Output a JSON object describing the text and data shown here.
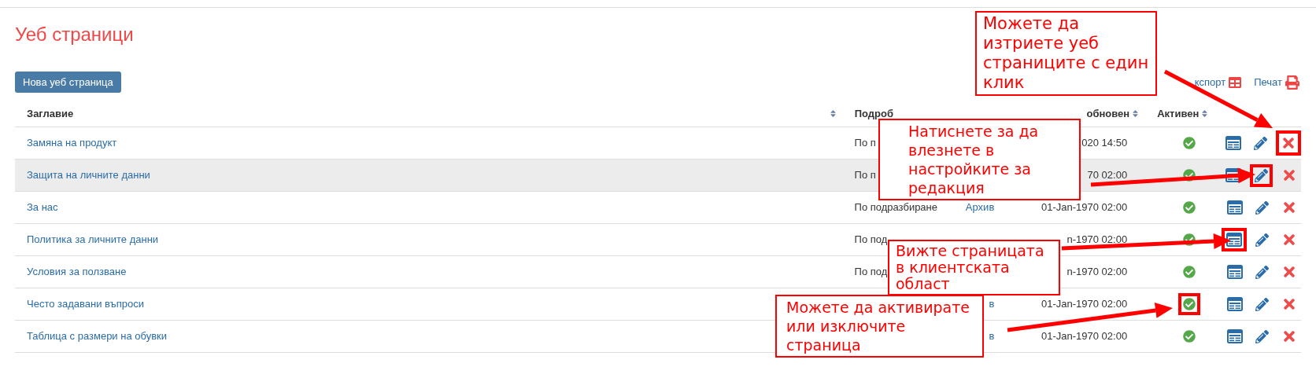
{
  "page_title": "Уеб страници",
  "new_button": "Нова уеб страница",
  "toolbar": [
    {
      "kind": "export",
      "label": "кспорт"
    },
    {
      "kind": "print",
      "label": "Печат"
    }
  ],
  "columns": [
    {
      "label": "Заглавие"
    },
    {
      "label": "Подроб"
    },
    {
      "label": "обновен"
    },
    {
      "label": "Активен"
    }
  ],
  "rows": [
    {
      "title": "Замяна на продукт",
      "details": "По п",
      "updated": "020 14:50",
      "active": true,
      "highlighted": false
    },
    {
      "title": "Защита на личните данни",
      "details": "По п",
      "updated": "70 02:00",
      "active": true,
      "highlighted": true
    },
    {
      "title": "За нас",
      "details": "По подразбиране",
      "archive": "Архив",
      "updated": "01-Jan-1970 02:00",
      "active": true,
      "highlighted": false
    },
    {
      "title": "Политика за личните данни",
      "details": "По под",
      "updated": "n-1970 02:00",
      "active": true,
      "highlighted": false
    },
    {
      "title": "Условия за ползване",
      "details": "По под",
      "updated": "n-1970 02:00",
      "active": true,
      "highlighted": false
    },
    {
      "title": "Често задавани въпроси",
      "archive": "в",
      "updated": "01-Jan-1970 02:00",
      "active": true,
      "highlighted": false
    },
    {
      "title": "Таблица с размери на обувки",
      "archive": "в",
      "updated": "01-Jan-1970 02:00",
      "active": true,
      "highlighted": false
    }
  ],
  "callouts": [
    {
      "kind": "delete",
      "text": "Можете да изтриете уеб страниците с един клик"
    },
    {
      "kind": "edit",
      "text": "Натиснете за да влезнете в настройките за редакция"
    },
    {
      "kind": "view",
      "text": "Вижте страницата в клиентската област"
    },
    {
      "kind": "active",
      "text": "Можете да активирате или изключите страница"
    }
  ]
}
